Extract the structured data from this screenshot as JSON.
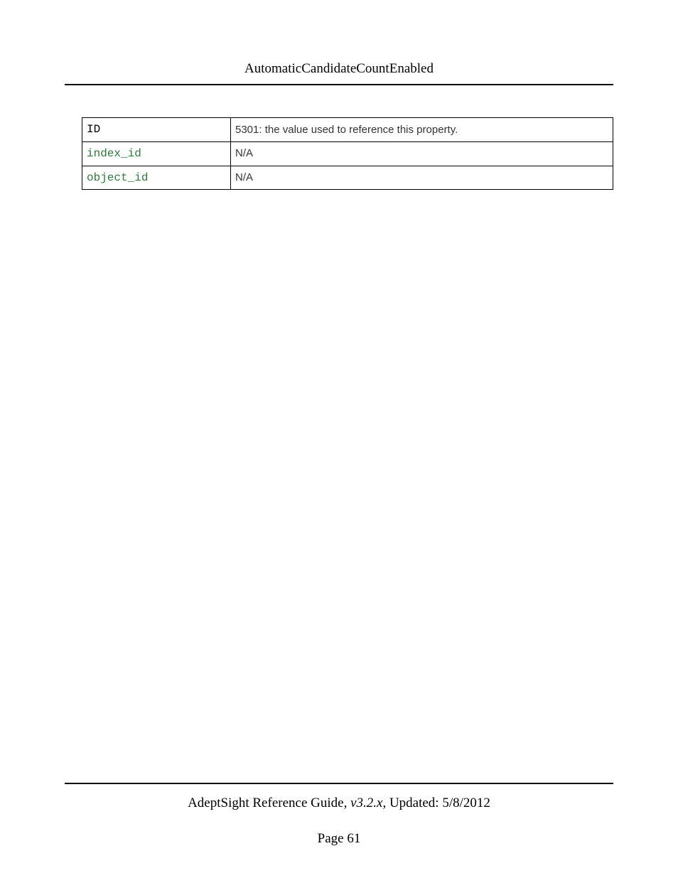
{
  "header": {
    "title": "AutomaticCandidateCountEnabled"
  },
  "table": {
    "rows": [
      {
        "key": "ID",
        "value": "5301: the value used to reference this property."
      },
      {
        "key": "index_id",
        "value": "N/A"
      },
      {
        "key": "object_id",
        "value": "N/A"
      }
    ]
  },
  "footer": {
    "guide": "AdeptSight Reference Guide",
    "sep1": ", ",
    "version": "v3.2.x",
    "sep2": ", Updated: ",
    "date": "5/8/2012",
    "page_label": "Page 61"
  }
}
